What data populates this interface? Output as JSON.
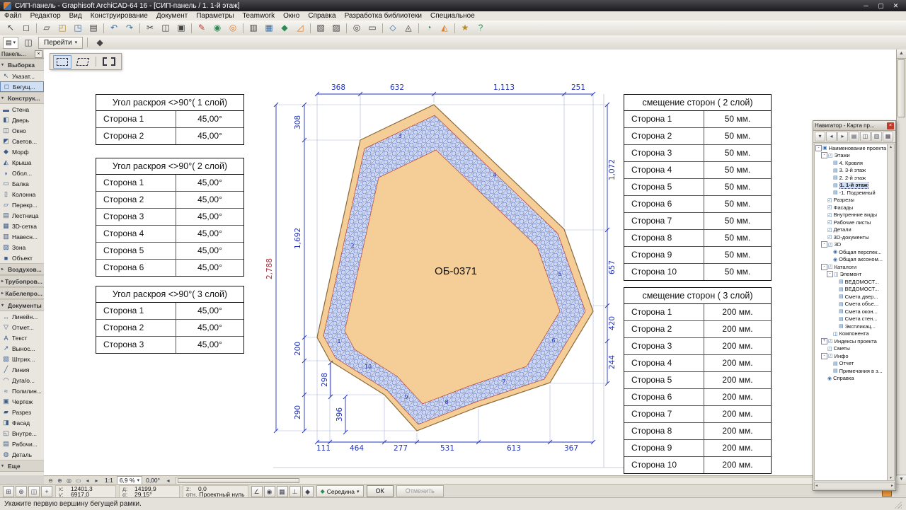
{
  "title": "СИП-панель - Graphisoft ArchiCAD-64 16 - [СИП-панель / 1. 1-й этаж]",
  "window_buttons": {
    "minimize": "─",
    "maximize": "▢",
    "close": "✕"
  },
  "menu": [
    "Файл",
    "Редактор",
    "Вид",
    "Конструирование",
    "Документ",
    "Параметры",
    "Teamwork",
    "Окно",
    "Справка",
    "Разработка библиотеки",
    "Специальное"
  ],
  "colors": {
    "panel_fill": "#f5cd97",
    "panel_edge": "#8a6a3a",
    "band_stroke": "#bb4433",
    "dim": "#2233bb",
    "dim_overall": "#aa3344"
  },
  "toolbar_icons": [
    {
      "name": "arrow-tool-icon",
      "g": "↖"
    },
    {
      "name": "marquee-tool-icon",
      "g": "◻"
    },
    {
      "sep": true
    },
    {
      "name": "new-file-icon",
      "g": "▱"
    },
    {
      "name": "open-file-icon",
      "g": "◰",
      "c": "#b58a2a"
    },
    {
      "name": "save-file-icon",
      "g": "◳",
      "c": "#3a6ea5"
    },
    {
      "name": "print-icon",
      "g": "▤"
    },
    {
      "sep": true
    },
    {
      "name": "undo-icon",
      "g": "↶",
      "c": "#3a6ea5"
    },
    {
      "name": "redo-icon",
      "g": "↷",
      "c": "#3a6ea5"
    },
    {
      "sep": true
    },
    {
      "name": "cut-icon",
      "g": "✂"
    },
    {
      "name": "copy-icon",
      "g": "◫"
    },
    {
      "name": "paste-icon",
      "g": "▣"
    },
    {
      "sep": true
    },
    {
      "name": "pen-icon",
      "g": "✎",
      "c": "#c0392b"
    },
    {
      "name": "pick-up-parameters-icon",
      "g": "◉",
      "c": "#2e8b57"
    },
    {
      "name": "inject-parameters-icon",
      "g": "◎",
      "c": "#e67e22"
    },
    {
      "sep": true
    },
    {
      "name": "layers-icon",
      "g": "▥"
    },
    {
      "name": "grid-snap-icon",
      "g": "▦",
      "c": "#3a6ea5"
    },
    {
      "name": "magnet-icon",
      "g": "◆",
      "c": "#2e8b57"
    },
    {
      "name": "guide-lines-icon",
      "g": "◿",
      "c": "#e67e22"
    },
    {
      "sep": true
    },
    {
      "name": "groups-icon",
      "g": "▧"
    },
    {
      "name": "lock-icon",
      "g": "▨"
    },
    {
      "sep": true
    },
    {
      "name": "zoom-icon",
      "g": "◎"
    },
    {
      "name": "fit-view-icon",
      "g": "▭"
    },
    {
      "sep": true
    },
    {
      "name": "3d-view-icon",
      "g": "◇",
      "c": "#3a6ea5"
    },
    {
      "name": "camera-icon",
      "g": "◬"
    },
    {
      "sep": true
    },
    {
      "name": "teamwork-icon",
      "g": "◔",
      "c": "#2e8b57"
    },
    {
      "name": "publish-icon",
      "g": "◭",
      "c": "#e67e22"
    },
    {
      "sep": true
    },
    {
      "name": "favorites-icon",
      "g": "★",
      "c": "#b58a2a"
    },
    {
      "name": "help-icon",
      "g": "?",
      "c": "#2e8b57"
    }
  ],
  "toolbar2": {
    "panel_glyph": "▤",
    "panel_arrow": "▾",
    "window_glyph": "◫",
    "go_label": "Перейти",
    "go_arrow": "▾",
    "pin_glyph": "◆"
  },
  "toolbox": {
    "title": "Панель...",
    "close_glyph": "×",
    "items": [
      {
        "type": "header",
        "exp": "▾",
        "label": "Выборка"
      },
      {
        "type": "tool",
        "icon": "pointer-icon",
        "glyph": "↖",
        "label": "Указат..."
      },
      {
        "type": "tool",
        "icon": "marquee-icon",
        "glyph": "◻",
        "label": "Бегущ...",
        "selected": true
      },
      {
        "type": "header",
        "exp": "▾",
        "label": "Конструк..."
      },
      {
        "type": "tool",
        "icon": "wall-icon",
        "glyph": "▬",
        "label": "Стена"
      },
      {
        "type": "tool",
        "icon": "door-icon",
        "glyph": "◧",
        "label": "Дверь"
      },
      {
        "type": "tool",
        "icon": "window-icon",
        "glyph": "◫",
        "label": "Окно"
      },
      {
        "type": "tool",
        "icon": "skylight-icon",
        "glyph": "◩",
        "label": "Светов..."
      },
      {
        "type": "tool",
        "icon": "morph-icon",
        "glyph": "◆",
        "label": "Морф"
      },
      {
        "type": "tool",
        "icon": "roof-icon",
        "glyph": "◭",
        "label": "Крыша"
      },
      {
        "type": "tool",
        "icon": "shell-icon",
        "glyph": "◗",
        "label": "Обол..."
      },
      {
        "type": "tool",
        "icon": "beam-icon",
        "glyph": "▭",
        "label": "Балка"
      },
      {
        "type": "tool",
        "icon": "column-icon",
        "glyph": "▯",
        "label": "Колонна"
      },
      {
        "type": "tool",
        "icon": "slab-icon",
        "glyph": "▱",
        "label": "Перекр..."
      },
      {
        "type": "tool",
        "icon": "stair-icon",
        "glyph": "▤",
        "label": "Лестница"
      },
      {
        "type": "tool",
        "icon": "mesh-icon",
        "glyph": "▦",
        "label": "3D-сетка"
      },
      {
        "type": "tool",
        "icon": "curtain-wall-icon",
        "glyph": "▥",
        "label": "Навесн..."
      },
      {
        "type": "tool",
        "icon": "zone-icon",
        "glyph": "▨",
        "label": "Зона"
      },
      {
        "type": "tool",
        "icon": "object-icon",
        "glyph": "■",
        "label": "Объект"
      },
      {
        "type": "header",
        "exp": "▸",
        "label": "Воздухов..."
      },
      {
        "type": "header",
        "exp": "▸",
        "label": "Трубопров..."
      },
      {
        "type": "header",
        "exp": "▸",
        "label": "Кабелепро..."
      },
      {
        "type": "header",
        "exp": "▾",
        "label": "Документы"
      },
      {
        "type": "tool",
        "icon": "dimension-icon",
        "glyph": "↔",
        "label": "Линейн..."
      },
      {
        "type": "tool",
        "icon": "level-mark-icon",
        "glyph": "▽",
        "label": "Отмет..."
      },
      {
        "type": "tool",
        "icon": "text-icon",
        "glyph": "A",
        "label": "Текст"
      },
      {
        "type": "tool",
        "icon": "label-icon",
        "glyph": "↗",
        "label": "Вынос..."
      },
      {
        "type": "tool",
        "icon": "fill-icon",
        "glyph": "▧",
        "label": "Штрих..."
      },
      {
        "type": "tool",
        "icon": "line-icon",
        "glyph": "╱",
        "label": "Линия"
      },
      {
        "type": "tool",
        "icon": "arc-icon",
        "glyph": "◠",
        "label": "Дуга/о..."
      },
      {
        "type": "tool",
        "icon": "polyline-icon",
        "glyph": "≈",
        "label": "Полилин..."
      },
      {
        "type": "tool",
        "icon": "drawing-icon",
        "glyph": "▣",
        "label": "Чертеж"
      },
      {
        "type": "tool",
        "icon": "section-icon",
        "glyph": "▰",
        "label": "Разрез"
      },
      {
        "type": "tool",
        "icon": "elevation-icon",
        "glyph": "◨",
        "label": "Фасад"
      },
      {
        "type": "tool",
        "icon": "interior-view-icon",
        "glyph": "◱",
        "label": "Внутре..."
      },
      {
        "type": "tool",
        "icon": "worksheet-icon",
        "glyph": "▤",
        "label": "Рабочи..."
      },
      {
        "type": "tool",
        "icon": "detail-icon",
        "glyph": "◍",
        "label": "Деталь"
      },
      {
        "type": "header",
        "exp": "▾",
        "label": "Еще"
      }
    ]
  },
  "canvas": {
    "panel_label": "ОБ-0371",
    "dims": {
      "top": [
        "368",
        "632",
        "1,113",
        "251"
      ],
      "bottom": [
        "111",
        "464",
        "277",
        "531",
        "613",
        "367"
      ],
      "left": [
        "308",
        "1,692",
        "200",
        "290"
      ],
      "right": [
        "1,072",
        "657",
        "420",
        "244"
      ],
      "overall": "2,788",
      "aux": [
        "298",
        "396"
      ],
      "edges": [
        "1",
        "2",
        "3",
        "4",
        "5",
        "6",
        "7",
        "8",
        "9",
        "10"
      ]
    },
    "tables_left": [
      {
        "title": "Угол раскроя <>90°( 1 слой)",
        "rows": [
          [
            "Сторона 1",
            "45,00°"
          ],
          [
            "Сторона 2",
            "45,00°"
          ]
        ]
      },
      {
        "title": "Угол раскроя <>90°( 2 слой)",
        "rows": [
          [
            "Сторона 1",
            "45,00°"
          ],
          [
            "Сторона 2",
            "45,00°"
          ],
          [
            "Сторона 3",
            "45,00°"
          ],
          [
            "Сторона 4",
            "45,00°"
          ],
          [
            "Сторона 5",
            "45,00°"
          ],
          [
            "Сторона 6",
            "45,00°"
          ]
        ]
      },
      {
        "title": "Угол раскроя <>90°( 3 слой)",
        "rows": [
          [
            "Сторона 1",
            "45,00°"
          ],
          [
            "Сторона 2",
            "45,00°"
          ],
          [
            "Сторона 3",
            "45,00°"
          ]
        ]
      }
    ],
    "tables_right": [
      {
        "title": "смещение сторон ( 2 слой)",
        "rows": [
          [
            "Сторона 1",
            "50 мм."
          ],
          [
            "Сторона 2",
            "50 мм."
          ],
          [
            "Сторона 3",
            "50 мм."
          ],
          [
            "Сторона 4",
            "50 мм."
          ],
          [
            "Сторона 5",
            "50 мм."
          ],
          [
            "Сторона 6",
            "50 мм."
          ],
          [
            "Сторона 7",
            "50 мм."
          ],
          [
            "Сторона 8",
            "50 мм."
          ],
          [
            "Сторона 9",
            "50 мм."
          ],
          [
            "Сторона 10",
            "50 мм."
          ]
        ]
      },
      {
        "title": "смещение сторон ( 3 слой)",
        "rows": [
          [
            "Сторона 1",
            "200 мм."
          ],
          [
            "Сторона 2",
            "200 мм."
          ],
          [
            "Сторона 3",
            "200 мм."
          ],
          [
            "Сторона 4",
            "200 мм."
          ],
          [
            "Сторона 5",
            "200 мм."
          ],
          [
            "Сторона 6",
            "200 мм."
          ],
          [
            "Сторона 7",
            "200 мм."
          ],
          [
            "Сторона 8",
            "200 мм."
          ],
          [
            "Сторона 9",
            "200 мм."
          ],
          [
            "Сторона 10",
            "200 мм."
          ]
        ]
      }
    ]
  },
  "navigator": {
    "title": "Навигатор - Карта пр...",
    "close_glyph": "×",
    "toolbar_icons": [
      {
        "name": "project-chooser-icon",
        "g": "▾"
      },
      {
        "name": "back-icon",
        "g": "◂"
      },
      {
        "name": "forward-icon",
        "g": "▸"
      },
      {
        "name": "project-map-icon",
        "g": "▤"
      },
      {
        "name": "view-map-icon",
        "g": "◫"
      },
      {
        "name": "layout-book-icon",
        "g": "▥"
      },
      {
        "name": "publisher-icon",
        "g": "▦"
      }
    ],
    "scroll_left_glyph": "◂",
    "scroll_right_glyph": "▸",
    "scroll_up_glyph": "▴",
    "scroll_down_glyph": "▾",
    "tree": [
      {
        "label": "Наименование проекта",
        "level": 0,
        "exp": "-",
        "icon": "project-icon",
        "g": "▣"
      },
      {
        "label": "Этажи",
        "level": 1,
        "exp": "-",
        "icon": "stories-folder-icon",
        "g": "◰"
      },
      {
        "label": "4. Кровля",
        "level": 2,
        "icon": "story-icon",
        "g": "▤"
      },
      {
        "label": "3. 3-й этаж",
        "level": 2,
        "icon": "story-icon",
        "g": "▤"
      },
      {
        "label": "2. 2-й этаж",
        "level": 2,
        "icon": "story-icon",
        "g": "▤"
      },
      {
        "label": "1. 1-й этаж",
        "level": 2,
        "icon": "story-icon",
        "g": "▤",
        "selected": true
      },
      {
        "label": "-1. Подземный",
        "level": 2,
        "icon": "story-icon",
        "g": "▤"
      },
      {
        "label": "Разрезы",
        "level": 1,
        "icon": "sections-folder-icon",
        "g": "◰"
      },
      {
        "label": "Фасады",
        "level": 1,
        "icon": "elevations-folder-icon",
        "g": "◰"
      },
      {
        "label": "Внутренние виды",
        "level": 1,
        "icon": "interior-views-folder-icon",
        "g": "◰"
      },
      {
        "label": "Рабочие листы",
        "level": 1,
        "icon": "worksheets-folder-icon",
        "g": "◰"
      },
      {
        "label": "Детали",
        "level": 1,
        "icon": "details-folder-icon",
        "g": "◰"
      },
      {
        "label": "3D-документы",
        "level": 1,
        "icon": "3d-documents-folder-icon",
        "g": "◰"
      },
      {
        "label": "3D",
        "level": 1,
        "exp": "-",
        "icon": "3d-folder-icon",
        "g": "◰"
      },
      {
        "label": "Общая перспек...",
        "level": 2,
        "icon": "perspective-view-icon",
        "g": "◉"
      },
      {
        "label": "Общая аксоном...",
        "level": 2,
        "icon": "axonometry-view-icon",
        "g": "◉"
      },
      {
        "label": "Каталоги",
        "level": 1,
        "exp": "-",
        "icon": "schedules-folder-icon",
        "g": "◰"
      },
      {
        "label": "Элемент",
        "level": 2,
        "exp": "-",
        "icon": "element-schedules-icon",
        "g": "◫"
      },
      {
        "label": "ВЕДОМОСТ...",
        "level": 3,
        "icon": "schedule-icon",
        "g": "▤"
      },
      {
        "label": "ВЕДОМОСТ...",
        "level": 3,
        "icon": "schedule-icon",
        "g": "▤"
      },
      {
        "label": "Смета двер...",
        "level": 3,
        "icon": "schedule-icon",
        "g": "▤"
      },
      {
        "label": "Смета объе...",
        "level": 3,
        "icon": "schedule-icon",
        "g": "▤"
      },
      {
        "label": "Смета окон...",
        "level": 3,
        "icon": "schedule-icon",
        "g": "▤"
      },
      {
        "label": "Смета стен...",
        "level": 3,
        "icon": "schedule-icon",
        "g": "▤"
      },
      {
        "label": "Экспликац...",
        "level": 3,
        "icon": "schedule-icon",
        "g": "▤"
      },
      {
        "label": "Компонента",
        "level": 2,
        "icon": "component-schedules-icon",
        "g": "◫"
      },
      {
        "label": "Индексы проекта",
        "level": 1,
        "exp": "+",
        "icon": "indexes-folder-icon",
        "g": "◰"
      },
      {
        "label": "Сметы",
        "level": 1,
        "icon": "lists-folder-icon",
        "g": "◰"
      },
      {
        "label": "Инфо",
        "level": 1,
        "exp": "-",
        "icon": "info-folder-icon",
        "g": "◰"
      },
      {
        "label": "Отчет",
        "level": 2,
        "icon": "report-icon",
        "g": "▤"
      },
      {
        "label": "Примечания в з...",
        "level": 2,
        "icon": "notes-icon",
        "g": "▤"
      },
      {
        "label": "Справка",
        "level": 1,
        "icon": "help-doc-icon",
        "g": "◉"
      }
    ]
  },
  "zoom_bar": {
    "icons": [
      {
        "name": "zoom-out-icon",
        "g": "⊖"
      },
      {
        "name": "zoom-in-icon",
        "g": "⊕"
      },
      {
        "name": "pan-icon",
        "g": "◎"
      },
      {
        "name": "fit-in-window-icon",
        "g": "▭"
      },
      {
        "name": "previous-view-icon",
        "g": "◂"
      },
      {
        "name": "next-view-icon",
        "g": "▸"
      }
    ],
    "ratio": "1:1",
    "zoom": "6,9 %",
    "zoom_arrow": "▾",
    "angle": "0,00°",
    "scroll_left_glyph": "◂",
    "scroll_right_glyph": "▸"
  },
  "coord_bar": {
    "left_icons": [
      {
        "name": "tracker-icon",
        "g": "⊞"
      },
      {
        "name": "origin-icon",
        "g": "⊕"
      },
      {
        "name": "ruler-icon",
        "g": "◫"
      },
      {
        "name": "user-origin-icon",
        "g": "+"
      }
    ],
    "pairs": [
      [
        {
          "label": "x:",
          "value": "12401,3"
        },
        {
          "label": "y:",
          "value": "6917,0"
        }
      ],
      [
        {
          "label": "д:",
          "value": "14199,9"
        },
        {
          "label": "α:",
          "value": "29,15°"
        }
      ],
      [
        {
          "label": "z:",
          "value": "0,0"
        },
        {
          "label": "отн.",
          "value": "Проектный нуль"
        }
      ]
    ],
    "mid_icons": [
      {
        "name": "relative-coords-icon",
        "g": "∠"
      },
      {
        "name": "polar-coords-icon",
        "g": "◉"
      },
      {
        "name": "grid-lock-icon",
        "g": "▦"
      },
      {
        "name": "gravity-icon",
        "g": "⊥"
      },
      {
        "name": "snap-settings-icon",
        "g": "◆"
      }
    ],
    "snap_glyph": "◆",
    "snap_label": "Середина",
    "snap_arrow": "▾",
    "ok": "ОК",
    "cancel": "Отменить"
  },
  "status": {
    "message": "Укажите первую вершину бегущей рамки."
  }
}
